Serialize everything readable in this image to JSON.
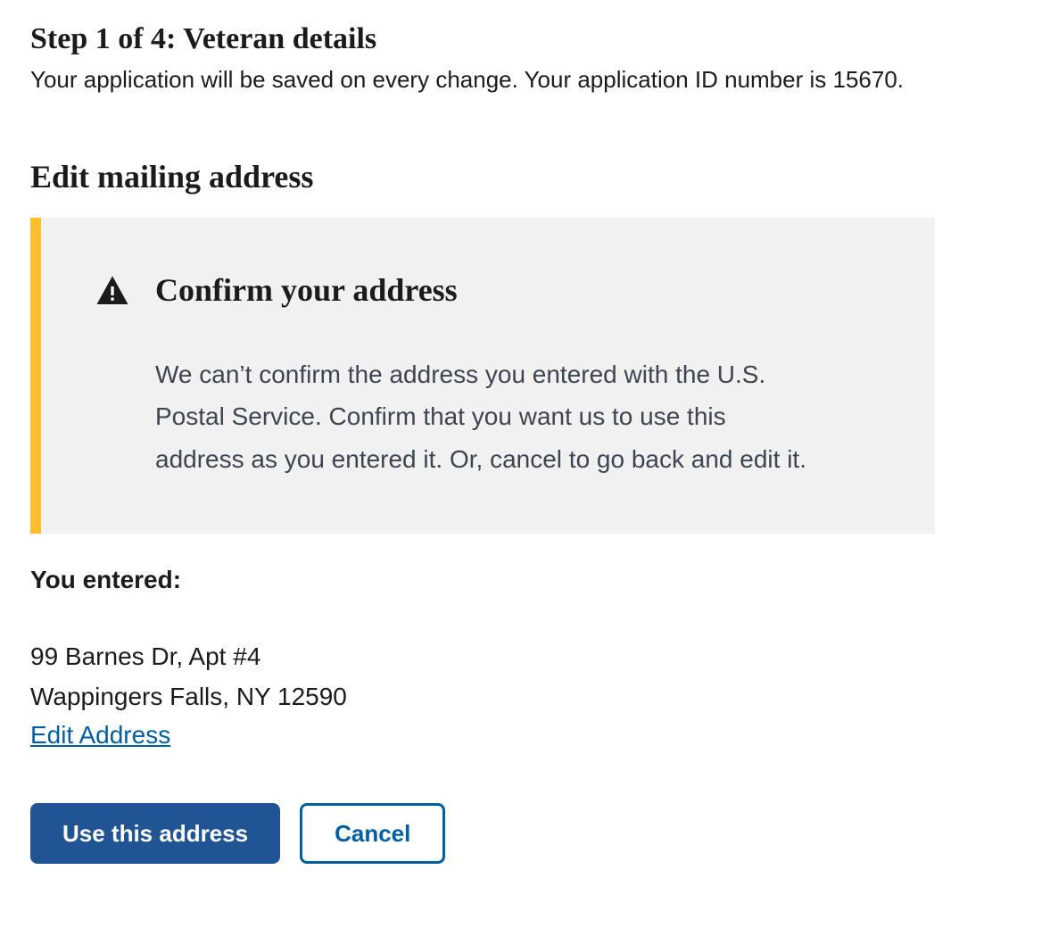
{
  "step": {
    "heading": "Step 1 of 4: Veteran details",
    "save_note": "Your application will be saved on every change. Your application ID number is 15670."
  },
  "section": {
    "heading": "Edit mailing address"
  },
  "alert": {
    "title": "Confirm your address",
    "body": "We can’t confirm the address you entered with the U.S. Postal Service. Confirm that you want us to use this address as you entered it. Or, cancel to go back and edit it."
  },
  "entered": {
    "label": "You entered:",
    "line1": "99 Barnes Dr, Apt #4",
    "line2": "Wappingers Falls, NY 12590",
    "edit_link": "Edit Address"
  },
  "buttons": {
    "primary": "Use this address",
    "secondary": "Cancel"
  }
}
